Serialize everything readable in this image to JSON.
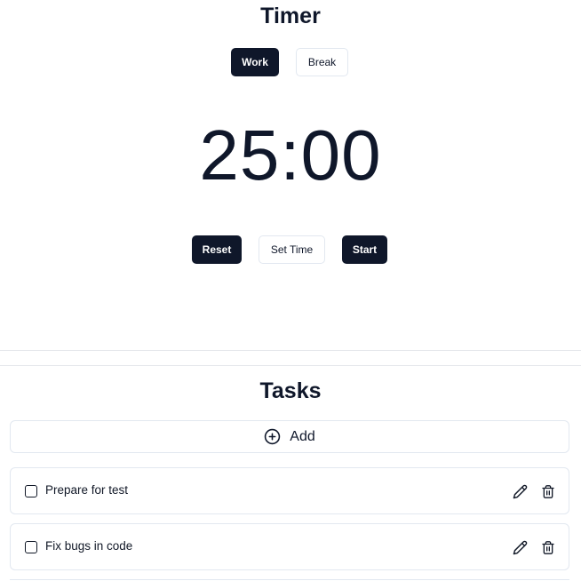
{
  "timer": {
    "title": "Timer",
    "modes": {
      "work": "Work",
      "break": "Break"
    },
    "time": "25:00",
    "controls": {
      "reset": "Reset",
      "set_time": "Set Time",
      "start": "Start"
    }
  },
  "tasks": {
    "title": "Tasks",
    "add_label": "Add",
    "items": [
      {
        "label": "Prepare for test",
        "checked": false
      },
      {
        "label": "Fix bugs in code",
        "checked": false
      }
    ]
  },
  "colors": {
    "primary": "#0f172a",
    "border": "#e2e8f0",
    "background": "#ffffff"
  },
  "icons": {
    "add": "plus-circle-icon",
    "edit": "pencil-icon",
    "delete": "trash-icon"
  }
}
